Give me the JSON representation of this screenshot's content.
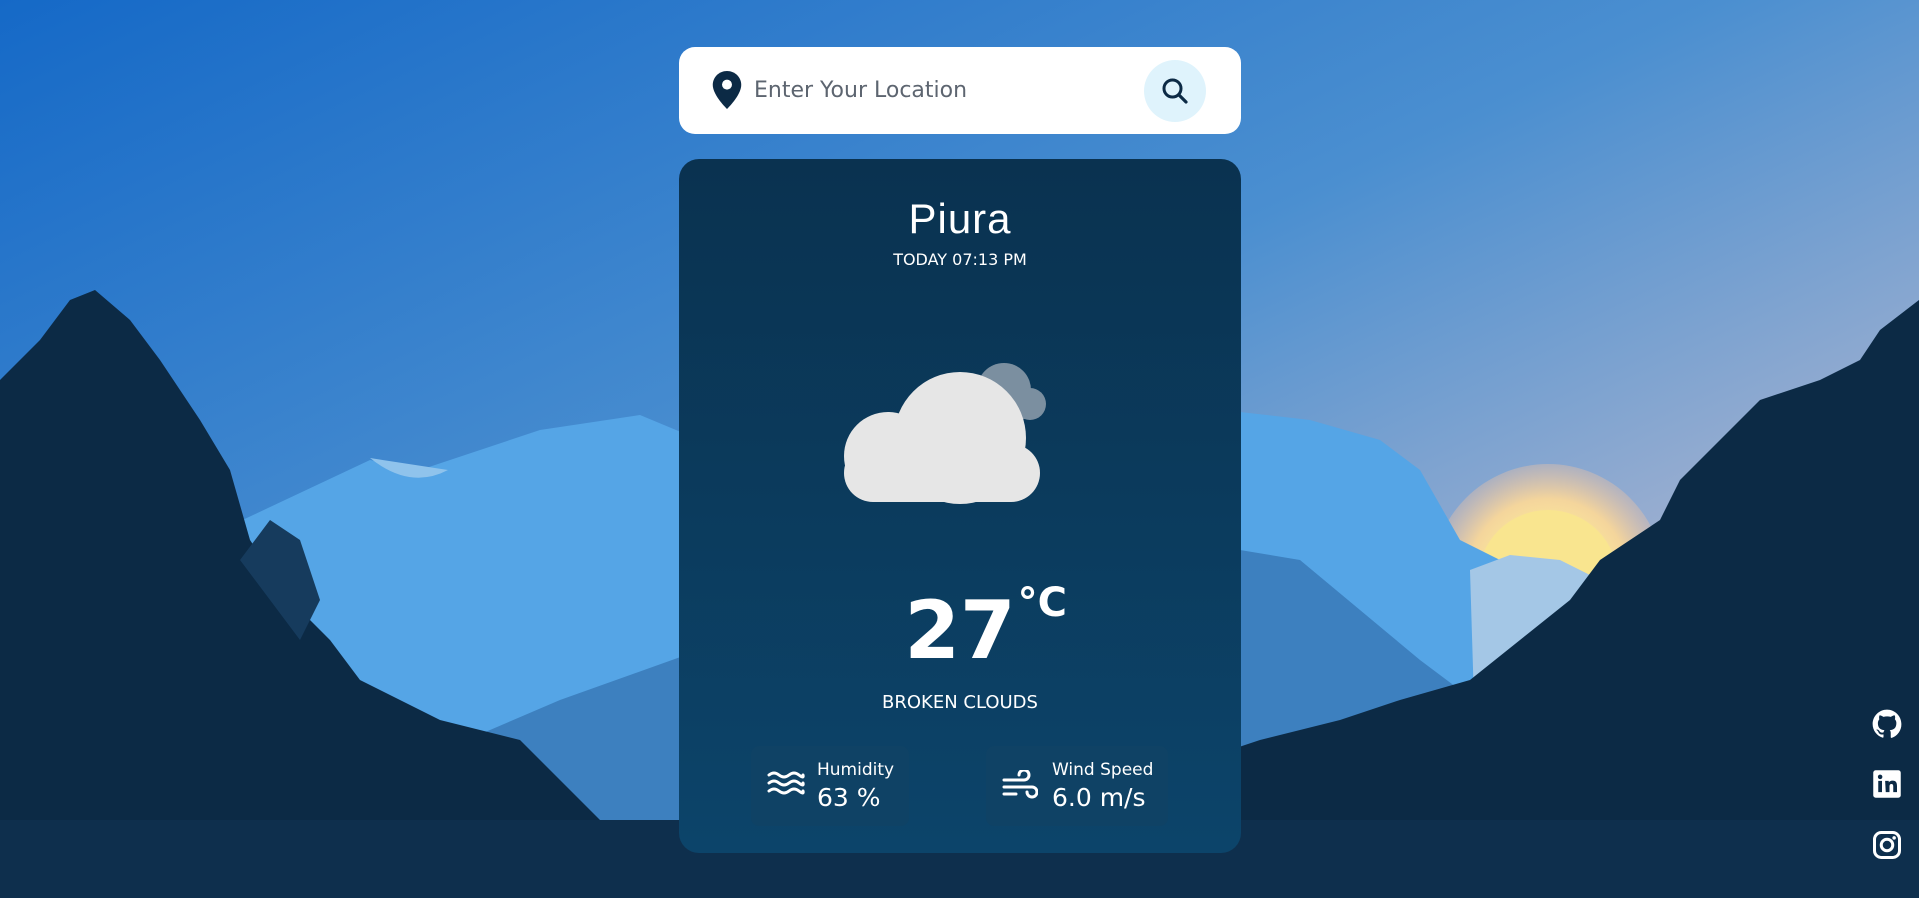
{
  "search": {
    "placeholder": "Enter Your Location"
  },
  "weather": {
    "city": "Piura",
    "datetime": "TODAY 07:13 PM",
    "temperature": "27",
    "unit": "°C",
    "condition": "BROKEN CLOUDS",
    "humidity": {
      "label": "Humidity",
      "value": "63 %"
    },
    "wind": {
      "label": "Wind Speed",
      "value": "6.0 m/s"
    }
  },
  "icons": {
    "location": "location-pin-icon",
    "search": "search-icon",
    "weather": "broken-clouds-icon",
    "humidity": "waves-icon",
    "wind": "wind-icon",
    "social": [
      "github-icon",
      "linkedin-icon",
      "instagram-icon"
    ]
  },
  "colors": {
    "card": "#0a3250",
    "sky_top": "#1a6fc9",
    "mountain": "#55a5e6",
    "silhouette": "#0c2a45",
    "accent_button": "#dff3fc"
  }
}
